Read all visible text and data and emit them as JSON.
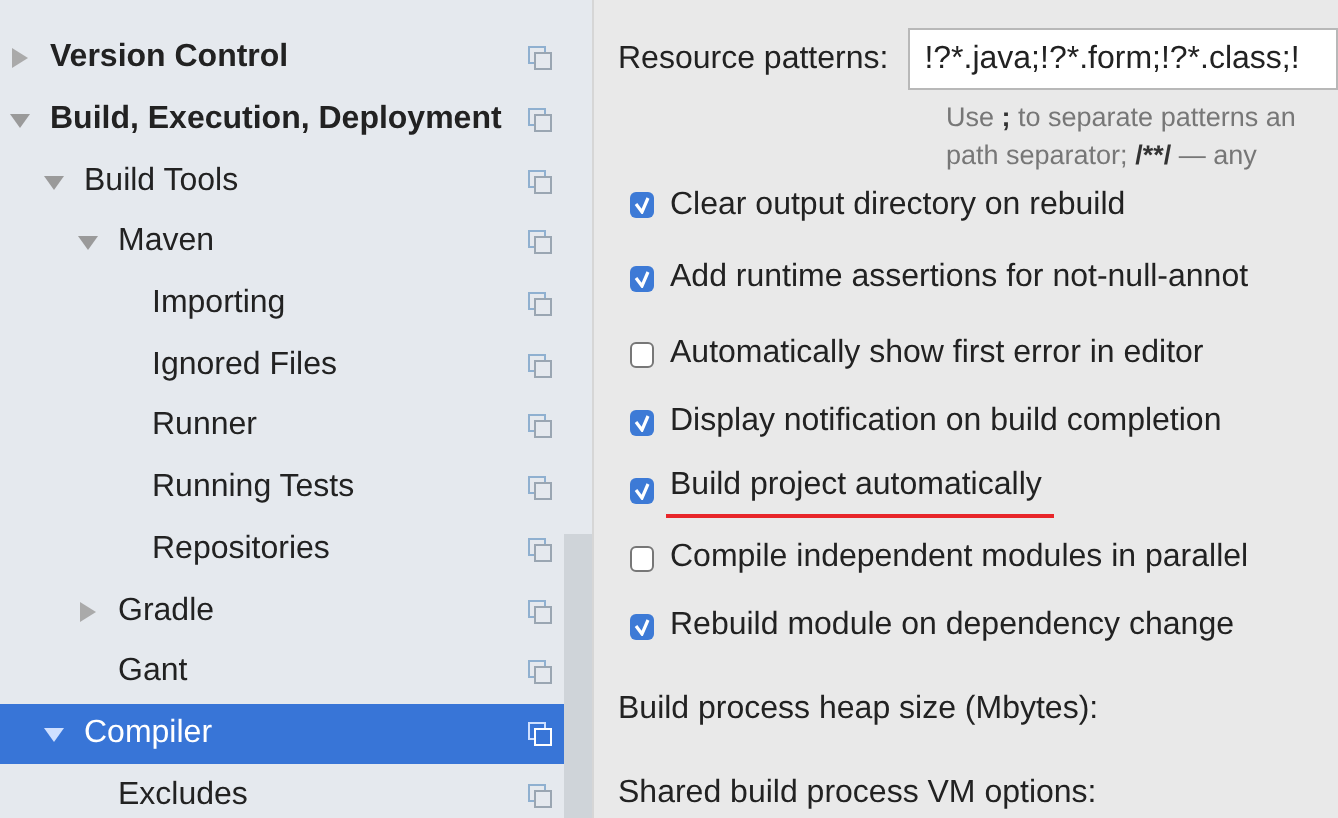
{
  "tree": [
    {
      "label": "Version Control",
      "bold": true,
      "selected": false,
      "expanded": false
    },
    {
      "label": "Build, Execution, Deployment",
      "bold": true,
      "selected": false,
      "expanded": true,
      "children": [
        {
          "label": "Build Tools",
          "bold": false,
          "selected": false,
          "expanded": true,
          "children": [
            {
              "label": "Maven",
              "bold": false,
              "selected": false,
              "expanded": true,
              "children": [
                {
                  "label": "Importing",
                  "bold": false,
                  "selected": false
                },
                {
                  "label": "Ignored Files",
                  "bold": false,
                  "selected": false
                },
                {
                  "label": "Runner",
                  "bold": false,
                  "selected": false
                },
                {
                  "label": "Running Tests",
                  "bold": false,
                  "selected": false
                },
                {
                  "label": "Repositories",
                  "bold": false,
                  "selected": false
                }
              ]
            },
            {
              "label": "Gradle",
              "bold": false,
              "selected": false,
              "expanded": false
            },
            {
              "label": "Gant",
              "bold": false,
              "selected": false
            }
          ]
        },
        {
          "label": "Compiler",
          "bold": false,
          "selected": true,
          "expanded": true,
          "children": [
            {
              "label": "Excludes",
              "bold": false,
              "selected": false
            }
          ]
        }
      ]
    }
  ],
  "resource_patterns": {
    "label": "Resource patterns:",
    "value": "!?*.java;!?*.form;!?*.class;!",
    "hint": [
      [
        {
          "text": "Use ",
          "bold": false
        },
        {
          "text": ";",
          "bold": true
        },
        {
          "text": " to separate patterns an",
          "bold": false
        }
      ],
      [
        {
          "text": "path separator; ",
          "bold": false
        },
        {
          "text": "/**/",
          "bold": true
        },
        {
          "text": " — any",
          "bold": false
        }
      ]
    ]
  },
  "options": [
    {
      "label": "Clear output directory on rebuild",
      "checked": true,
      "underlined": false
    },
    {
      "label": "Add runtime assertions for not-null-annot",
      "checked": true,
      "underlined": false
    },
    {
      "label": "Automatically show first error in editor",
      "checked": false,
      "underlined": false
    },
    {
      "label": "Display notification on build completion",
      "checked": true,
      "underlined": false
    },
    {
      "label": "Build project automatically",
      "checked": true,
      "underlined": true
    },
    {
      "label": "Compile independent modules in parallel",
      "checked": false,
      "underlined": false
    },
    {
      "label": "Rebuild module on dependency change",
      "checked": true,
      "underlined": false
    }
  ],
  "fields": [
    {
      "label": "Build process heap size (Mbytes):"
    },
    {
      "label": "Shared build process VM options:"
    }
  ]
}
